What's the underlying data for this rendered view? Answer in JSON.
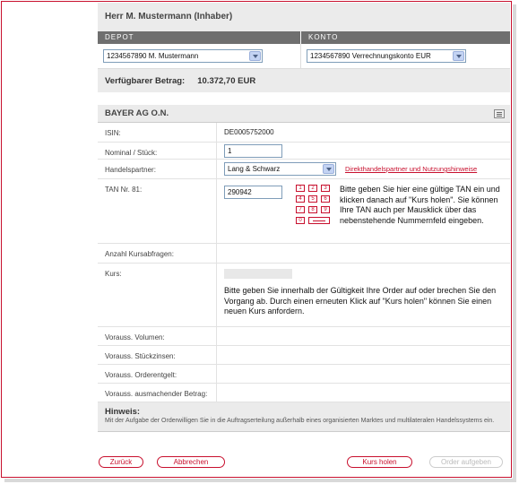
{
  "owner": "Herr M. Mustermann (Inhaber)",
  "depot": {
    "header": "DEPOT",
    "selected": "1234567890 M. Mustermann"
  },
  "konto": {
    "header": "KONTO",
    "selected": "1234567890 Verrechnungskonto EUR"
  },
  "available": {
    "label": "Verfügbarer Betrag:",
    "amount": "10.372,70 EUR"
  },
  "security": {
    "name": "BAYER AG O.N."
  },
  "fields": {
    "isin": {
      "label": "ISIN:",
      "value": "DE0005752000"
    },
    "nominal": {
      "label": "Nominal / Stück:",
      "value": "1"
    },
    "partner": {
      "label": "Handelspartner:",
      "value": "Lang & Schwarz",
      "link": "Direkthandelspartner und Nutzungshinweise"
    },
    "tan": {
      "label": "TAN Nr. 81:",
      "value": "290942",
      "instructions": "Bitte geben Sie hier eine gültige TAN ein und klicken danach auf \"Kurs holen\". Sie können Ihre TAN auch per Mausklick über das nebenstehende Nummernfeld eingeben.",
      "keys": [
        "1",
        "2",
        "3",
        "4",
        "5",
        "6",
        "7",
        "8",
        "9",
        "0"
      ]
    },
    "anzahl": {
      "label": "Anzahl Kursabfragen:"
    },
    "kurs": {
      "label": "Kurs:",
      "text": "Bitte geben Sie innerhalb der Gültigkeit Ihre Order auf oder brechen Sie den Vorgang ab. Durch einen erneuten Klick auf \"Kurs holen\" können Sie einen neuen Kurs anfordern."
    },
    "volumen": {
      "label": "Vorauss. Volumen:"
    },
    "stueckzinsen": {
      "label": "Vorauss. Stückzinsen:"
    },
    "entgelt": {
      "label": "Vorauss. Orderentgelt:"
    },
    "betrag": {
      "label": "Vorauss. ausmachender Betrag:"
    }
  },
  "hint": {
    "title": "Hinweis:",
    "text": "Mit der Aufgabe der Orderwilligen Sie in die Auftragserteilung außerhalb eines organisierten Marktes und multilateralen Handelssystems ein."
  },
  "buttons": {
    "back": "Zurück",
    "cancel": "Abbrechen",
    "quote": "Kurs holen",
    "submit": "Order aufgeben"
  },
  "colors": {
    "accent": "#c8102e",
    "header_bar": "#6f6f6f"
  }
}
